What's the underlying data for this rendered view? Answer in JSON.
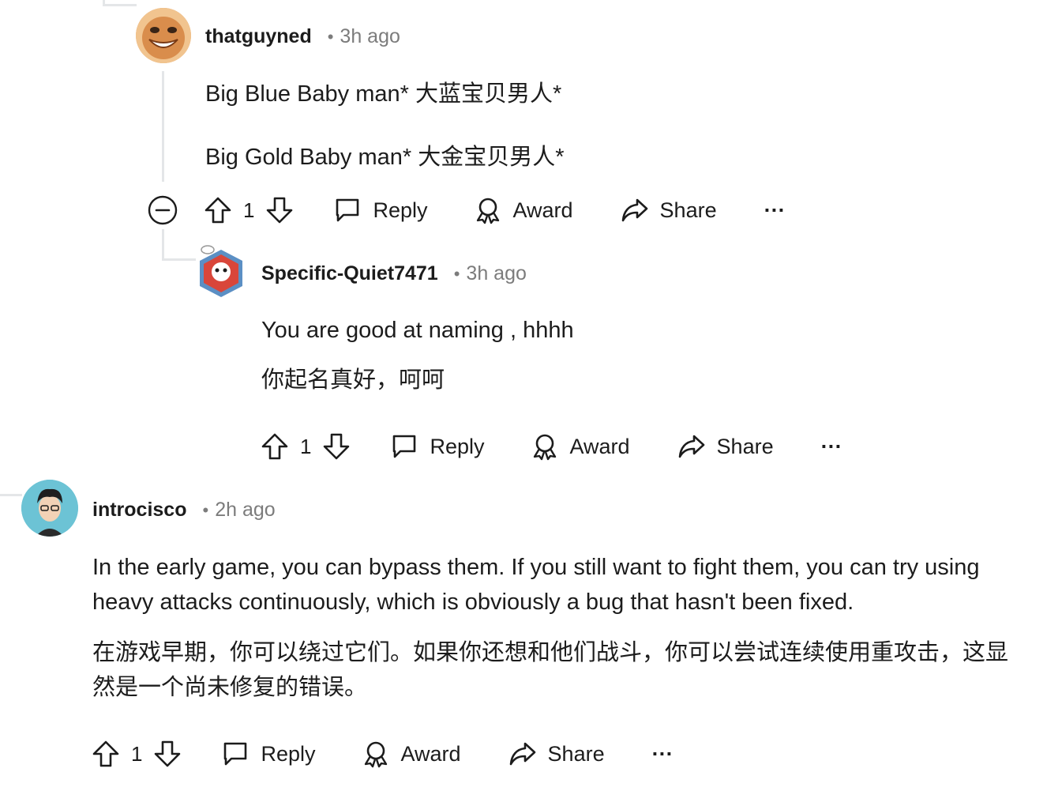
{
  "comments": [
    {
      "username": "thatguyned",
      "separator": "•",
      "time": "3h ago",
      "lines": [
        "Big Blue Baby man*  大蓝宝贝男人*",
        "Big Gold Baby man*  大金宝贝男人*"
      ],
      "votes": "1",
      "actions": {
        "reply": "Reply",
        "award": "Award",
        "share": "Share",
        "more": "···"
      }
    },
    {
      "username": "Specific-Quiet7471",
      "separator": "•",
      "time": "3h ago",
      "lines": [
        "You are good at naming , hhhh",
        "你起名真好，呵呵"
      ],
      "votes": "1",
      "actions": {
        "reply": "Reply",
        "award": "Award",
        "share": "Share",
        "more": "···"
      }
    },
    {
      "username": "introcisco",
      "separator": "•",
      "time": "2h ago",
      "lines": [
        "In the early game, you can bypass them. If you still want to fight them, you can try using heavy attacks continuously, which is obviously a bug that hasn't been fixed.",
        "在游戏早期，你可以绕过它们。如果你还想和他们战斗，你可以尝试连续使用重攻击，这显然是一个尚未修复的错误。"
      ],
      "votes": "1",
      "actions": {
        "reply": "Reply",
        "award": "Award",
        "share": "Share",
        "more": "···"
      }
    }
  ],
  "colors": {
    "text": "#1c1c1c",
    "meta": "#7c7c7c",
    "thread_line": "#e4e6e8"
  }
}
